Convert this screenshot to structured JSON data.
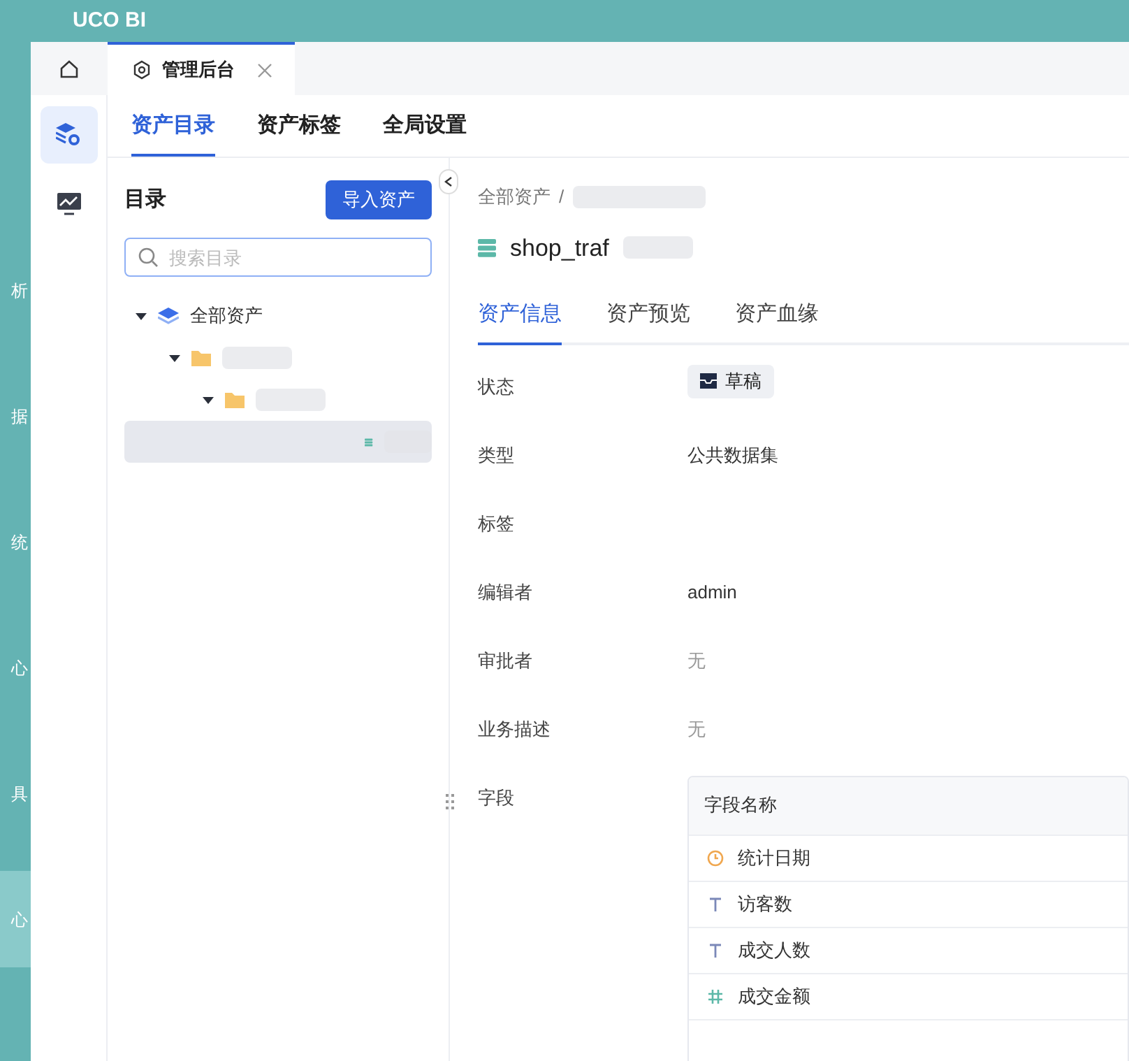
{
  "app": {
    "title": "UCO BI"
  },
  "side_menu": [
    {
      "label": "析",
      "selected": false
    },
    {
      "label": "据",
      "selected": false
    },
    {
      "label": "统",
      "selected": false
    },
    {
      "label": "心",
      "selected": false
    },
    {
      "label": "具",
      "selected": false
    },
    {
      "label": "心",
      "selected": true
    }
  ],
  "icon_rail": [
    {
      "kind": "assets",
      "selected": true
    },
    {
      "kind": "monitor",
      "selected": false
    }
  ],
  "page_tabs": [
    {
      "label": "管理后台",
      "selected": true
    }
  ],
  "module_tabs": [
    {
      "label": "资产目录",
      "selected": true
    },
    {
      "label": "资产标签",
      "selected": false
    },
    {
      "label": "全局设置",
      "selected": false
    }
  ],
  "catalog": {
    "title": "目录",
    "import_button": "导入资产",
    "search": {
      "placeholder": "搜索目录"
    },
    "tree": [
      {
        "kind": "root",
        "label": "全部资产",
        "expanded": true,
        "selected": false,
        "children": [
          {
            "kind": "folder",
            "expanded": true,
            "selected": false,
            "children": [
              {
                "kind": "folder",
                "expanded": true,
                "selected": false,
                "children": [
                  {
                    "kind": "table",
                    "selected": true
                  }
                ]
              }
            ]
          }
        ]
      }
    ]
  },
  "asset": {
    "breadcrumb": [
      "全部资产",
      "/"
    ],
    "title": "shop_traf",
    "tabs": [
      {
        "label": "资产信息",
        "selected": true
      },
      {
        "label": "资产预览",
        "selected": false
      },
      {
        "label": "资产血缘",
        "selected": false
      }
    ],
    "info": [
      {
        "label": "状态",
        "kind": "badge",
        "value": "草稿"
      },
      {
        "label": "类型",
        "kind": "text",
        "value": "公共数据集"
      },
      {
        "label": "标签",
        "kind": "empty"
      },
      {
        "label": "编辑者",
        "kind": "text",
        "value": "admin"
      },
      {
        "label": "审批者",
        "kind": "muted",
        "value": "无"
      },
      {
        "label": "业务描述",
        "kind": "muted",
        "value": "无"
      },
      {
        "label": "字段",
        "kind": "fields"
      }
    ],
    "fields": {
      "header": "字段名称",
      "rows": [
        {
          "kind": "date",
          "name": "统计日期"
        },
        {
          "kind": "text",
          "name": "访客数"
        },
        {
          "kind": "text",
          "name": "成交人数"
        },
        {
          "kind": "number",
          "name": "成交金额"
        }
      ]
    }
  }
}
